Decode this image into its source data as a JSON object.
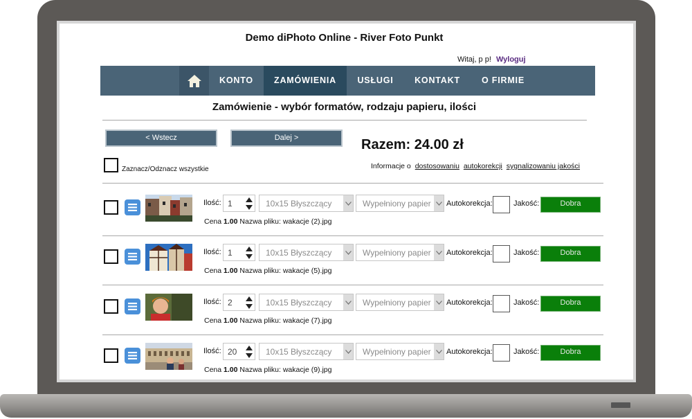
{
  "site": {
    "title": "Demo diPhoto Online - River Foto Punkt",
    "greeting": "Witaj, p p!",
    "logout": "Wyloguj"
  },
  "nav": {
    "home_icon": "home-icon",
    "items": [
      {
        "label": "KONTO",
        "active": false
      },
      {
        "label": "ZAMÓWIENIA",
        "active": true
      },
      {
        "label": "USŁUGI",
        "active": false
      },
      {
        "label": "KONTAKT",
        "active": false
      },
      {
        "label": "O FIRMIE",
        "active": false
      }
    ]
  },
  "page": {
    "heading": "Zamówienie - wybór formatów, rodzaju papieru, ilości",
    "back_label": "< Wstecz",
    "next_label": "Dalej >",
    "total": "Razem: 24.00 zł",
    "select_all": "Zaznacz/Odznacz wszystkie",
    "info_prefix": "Informacje o",
    "info_links": [
      "dostosowaniu",
      "autokorekcji",
      "sygnalizowaniu jakości"
    ]
  },
  "labels": {
    "qty": "Ilość:",
    "autocorrect": "Autokorekcja:",
    "quality": "Jakość:",
    "price": "Cena",
    "filename": "Nazwa pliku:"
  },
  "rows": [
    {
      "qty": "1",
      "format": "10x15 Błyszczący",
      "paper": "Wypełniony papier",
      "quality": "Dobra",
      "price": "1.00",
      "filename": "wakacje (2).jpg",
      "thumb": "street-buildings-photo"
    },
    {
      "qty": "1",
      "format": "10x15 Błyszczący",
      "paper": "Wypełniony papier",
      "quality": "Dobra",
      "price": "1.00",
      "filename": "wakacje (5).jpg",
      "thumb": "half-timbered-houses-photo"
    },
    {
      "qty": "2",
      "format": "10x15 Błyszczący",
      "paper": "Wypełniony papier",
      "quality": "Dobra",
      "price": "1.00",
      "filename": "wakacje (7).jpg",
      "thumb": "child-portrait-photo"
    },
    {
      "qty": "20",
      "format": "10x15 Błyszczący",
      "paper": "Wypełniony papier",
      "quality": "Dobra",
      "price": "1.00",
      "filename": "wakacje (9).jpg",
      "thumb": "colosseum-tourists-photo"
    }
  ],
  "colors": {
    "nav_bg": "#4a6477",
    "nav_active": "#2a4a5e",
    "quality_good": "#0a7f0a",
    "menu_button": "#4a90d9",
    "frame": "#5c5956"
  }
}
